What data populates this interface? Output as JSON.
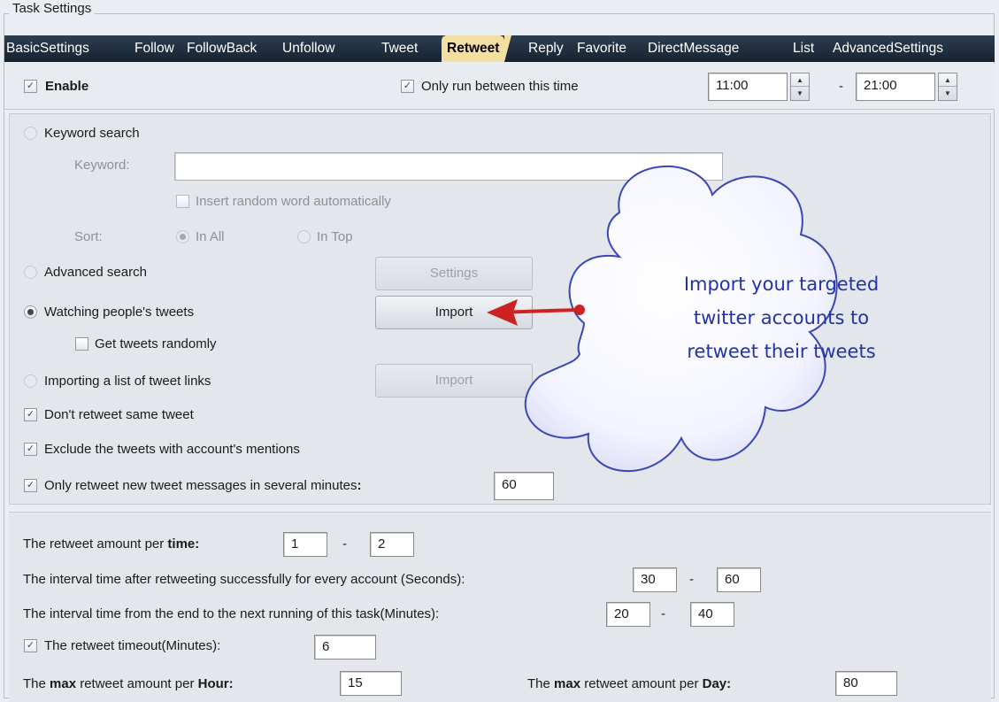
{
  "frame": {
    "title": "Task Settings"
  },
  "tabs": [
    {
      "label": "BasicSettings"
    },
    {
      "label": "Follow"
    },
    {
      "label": "FollowBack"
    },
    {
      "label": "Unfollow"
    },
    {
      "label": "Tweet"
    },
    {
      "label": "Retweet"
    },
    {
      "label": "Reply"
    },
    {
      "label": "Favorite"
    },
    {
      "label": "DirectMessage"
    },
    {
      "label": "List"
    },
    {
      "label": "AdvancedSettings"
    }
  ],
  "active_tab": "Retweet",
  "top": {
    "enable_label": "Enable",
    "only_run_label": "Only run between this time",
    "start_time": "11:00",
    "dash": "-",
    "end_time": "21:00"
  },
  "search": {
    "keyword_search_label": "Keyword search",
    "keyword_label": "Keyword:",
    "keyword_value": "",
    "insert_random_label": "Insert random word automatically",
    "sort_label": "Sort:",
    "in_all_label": "In All",
    "in_top_label": "In Top",
    "advanced_search_label": "Advanced search",
    "settings_button": "Settings",
    "watching_label": "Watching people's tweets",
    "import_button": "Import",
    "get_random_label": "Get tweets randomly",
    "importing_list_label": "Importing a list of tweet links",
    "import_button2": "Import",
    "dont_retweet_label": "Don't retweet same tweet",
    "exclude_label": "Exclude the tweets with account's mentions",
    "only_new_label_a": "Only retweet new tweet messages in several minutes",
    "only_new_colon": ":",
    "only_new_value": "60"
  },
  "amounts": {
    "per_time_a": "The retweet amount per ",
    "per_time_b": "time:",
    "per_time_min": "1",
    "dash": "-",
    "per_time_max": "2",
    "interval_success_label": "The interval time after retweeting successfully for every account (Seconds):",
    "interval_success_min": "30",
    "interval_success_max": "60",
    "interval_task_label": "The interval time from the end to the next running of this task(Minutes):",
    "interval_task_min": "20",
    "interval_task_max": "40",
    "timeout_label": "The retweet timeout(Minutes):",
    "timeout_value": "6",
    "max_hour_a": "The ",
    "max_hour_b": "max",
    "max_hour_c": " retweet amount per ",
    "max_hour_d": "Hour:",
    "max_hour_value": "15",
    "max_day_a": "The ",
    "max_day_b": "max",
    "max_day_c": " retweet amount per ",
    "max_day_d": "Day:",
    "max_day_value": "80"
  },
  "callout": {
    "lines": [
      "Import your targeted",
      "twitter accounts to",
      "retweet their tweets"
    ],
    "text_color": "#2233aa",
    "arrow_color": "#cc2222"
  }
}
